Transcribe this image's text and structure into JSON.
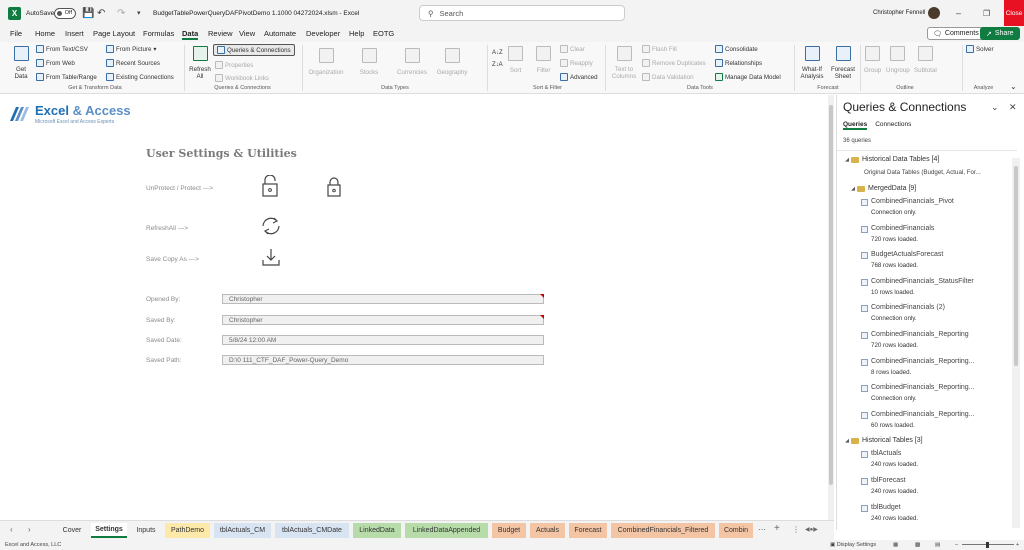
{
  "titlebar": {
    "autosave_label": "AutoSave",
    "autosave_state": "Off",
    "filename": "BudgetTablePowerQueryDAFPivotDemo 1.1000  04272024.xlsm  -  Excel",
    "search_placeholder": "Search",
    "user_name": "Christopher Fennell",
    "close_label": "Close"
  },
  "menu": {
    "items": [
      "File",
      "Home",
      "Insert",
      "Page Layout",
      "Formulas",
      "Data",
      "Review",
      "View",
      "Automate",
      "Developer",
      "Help",
      "EOTG"
    ],
    "active": "Data",
    "comments_label": "Comments",
    "share_label": "Share"
  },
  "ribbon": {
    "get_data": "Get Data",
    "from_text_csv": "From Text/CSV",
    "from_web": "From Web",
    "from_table_range": "From Table/Range",
    "from_picture": "From Picture",
    "recent_sources": "Recent Sources",
    "existing_connections": "Existing Connections",
    "group_get_transform": "Get & Transform Data",
    "refresh_all": "Refresh All",
    "queries_connections": "Queries & Connections",
    "properties": "Properties",
    "workbook_links": "Workbook Links",
    "group_queries": "Queries & Connections",
    "data_types": [
      "Organization",
      "Stocks",
      "Currencies",
      "Geography"
    ],
    "group_data_types": "Data Types",
    "sort": "Sort",
    "filter": "Filter",
    "clear": "Clear",
    "reapply": "Reapply",
    "advanced": "Advanced",
    "group_sort_filter": "Sort & Filter",
    "text_to_columns": "Text to Columns",
    "flash_fill": "Flash Fill",
    "remove_duplicates": "Remove Duplicates",
    "data_validation": "Data Validation",
    "consolidate": "Consolidate",
    "relationships": "Relationships",
    "manage_data_model": "Manage Data Model",
    "group_data_tools": "Data Tools",
    "what_if": "What-If Analysis",
    "forecast_sheet": "Forecast Sheet",
    "group_forecast": "Forecast",
    "group": "Group",
    "ungroup": "Ungroup",
    "subtotal": "Subtotal",
    "group_outline": "Outline",
    "solver": "Solver",
    "group_analyze": "Analyze"
  },
  "brand": {
    "title_a": "Excel",
    "title_b": " & Access",
    "subtitle": "Microsoft Excel and Access Experts"
  },
  "sheet": {
    "heading": "User Settings & Utilities",
    "unprotect_label": "UnProtect / Protect --->",
    "refresh_label": "RefreshAll --->",
    "save_copy_label": "Save Copy As --->",
    "fields": [
      {
        "label": "Opened By:",
        "value": "Christopher"
      },
      {
        "label": "Saved By:",
        "value": "Christopher"
      },
      {
        "label": "Saved Date:",
        "value": "5/8/24 12:00 AM"
      },
      {
        "label": "Saved Path:",
        "value": "D:\\0    111_CTF_DAF_Power-Query_Demo"
      }
    ]
  },
  "pane": {
    "title": "Queries & Connections",
    "tab_queries": "Queries",
    "tab_connections": "Connections",
    "count": "36 queries",
    "group1": "Historical Data Tables [4]",
    "group1_desc": "Original Data Tables (Budget, Actual, For...",
    "group2": "MergedData [9]",
    "merged": [
      {
        "name": "CombinedFinancials_Pivot",
        "status": "Connection only."
      },
      {
        "name": "CombinedFinancials",
        "status": "720 rows loaded."
      },
      {
        "name": "BudgetActualsForecast",
        "status": "768 rows loaded."
      },
      {
        "name": "CombinedFinancials_StatusFilter",
        "status": "10 rows loaded."
      },
      {
        "name": "CombinedFinancials (2)",
        "status": "Connection only."
      },
      {
        "name": "CombinedFinancials_Reporting",
        "status": "720 rows loaded."
      },
      {
        "name": "CombinedFinancials_Reporting...",
        "status": "8 rows loaded."
      },
      {
        "name": "CombinedFinancials_Reporting...",
        "status": "Connection only."
      },
      {
        "name": "CombinedFinancials_Reporting...",
        "status": "60 rows loaded."
      }
    ],
    "group3": "Historical Tables [3]",
    "historical": [
      {
        "name": "tblActuals",
        "status": "240 rows loaded."
      },
      {
        "name": "tblForecast",
        "status": "240 rows loaded."
      },
      {
        "name": "tblBudget",
        "status": "240 rows loaded."
      }
    ]
  },
  "tabs": {
    "items": [
      {
        "label": "Cover",
        "color": ""
      },
      {
        "label": "Settings",
        "color": "",
        "active": true
      },
      {
        "label": "Inputs",
        "color": ""
      },
      {
        "label": "PathDemo",
        "color": "#fde9a9"
      },
      {
        "label": "tblActuals_CM",
        "color": "#d9e4f2"
      },
      {
        "label": "tblActuals_CMDate",
        "color": "#d9e4f2"
      },
      {
        "label": "LinkedData",
        "color": "#b7dcaa"
      },
      {
        "label": "LinkedDataAppended",
        "color": "#b7dcaa"
      },
      {
        "label": "Budget",
        "color": "#f4c5a4"
      },
      {
        "label": "Actuals",
        "color": "#f4c5a4"
      },
      {
        "label": "Forecast",
        "color": "#f4c5a4"
      },
      {
        "label": "CombinedFinancials_Filtered",
        "color": "#f4c5a4"
      },
      {
        "label": "Combin",
        "color": "#f4c5a4"
      }
    ]
  },
  "status": {
    "left": "Excel and Access, LLC",
    "display_settings": "Display Settings"
  }
}
